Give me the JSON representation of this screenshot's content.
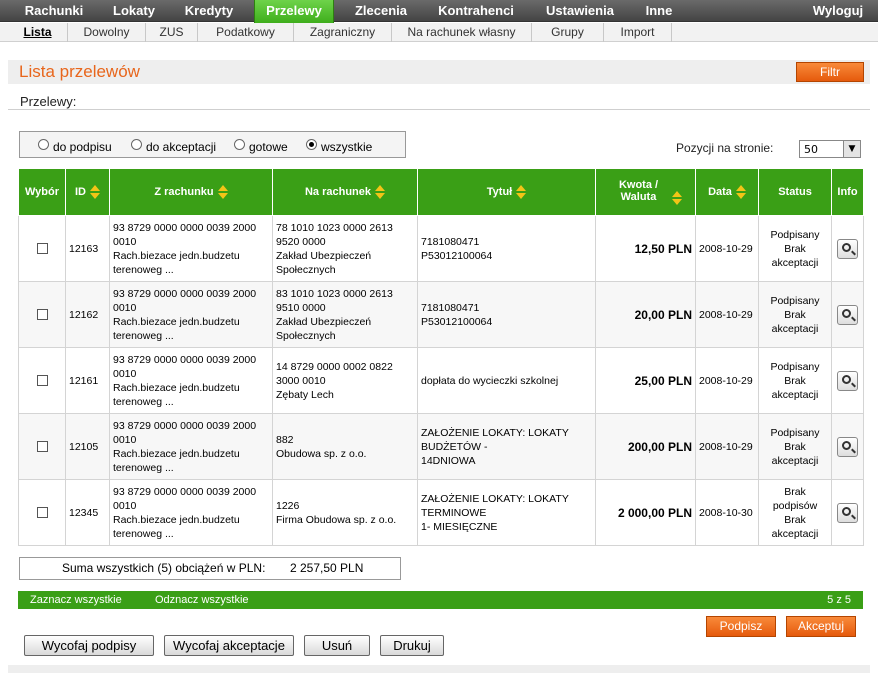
{
  "top_nav": {
    "items": [
      "Rachunki",
      "Lokaty",
      "Kredyty",
      "Przelewy",
      "Zlecenia",
      "Kontrahenci",
      "Ustawienia",
      "Inne"
    ],
    "active": "Przelewy",
    "logout": "Wyloguj"
  },
  "sub_nav": {
    "items": [
      "Lista",
      "Dowolny",
      "ZUS",
      "Podatkowy",
      "Zagraniczny",
      "Na rachunek własny",
      "Grupy",
      "Import"
    ],
    "active": "Lista"
  },
  "header": {
    "title": "Lista przelewów",
    "filter_button": "Filtr"
  },
  "section_label": "Przelewy:",
  "filter": {
    "options": [
      "do podpisu",
      "do akceptacji",
      "gotowe",
      "wszystkie"
    ],
    "selected": "wszystkie"
  },
  "per_page": {
    "label": "Pozycji na stronie:",
    "value": "50"
  },
  "table": {
    "columns": [
      "Wybór",
      "ID",
      "Z rachunku",
      "Na rachunek",
      "Tytuł",
      "Kwota / Waluta",
      "Data",
      "Status",
      "Info"
    ],
    "rows": [
      {
        "id": "12163",
        "from": [
          "93 8729 0000 0000 0039 2000 0010",
          "Rach.biezace jedn.budzetu terenoweg ..."
        ],
        "to": [
          "78 1010 1023 0000 2613 9520 0000",
          "Zakład Ubezpieczeń Społecznych"
        ],
        "title": [
          "7181080471",
          "P53012100064"
        ],
        "amount": "12,50 PLN",
        "date": "2008-10-29",
        "status": [
          "Podpisany",
          "Brak akceptacji"
        ]
      },
      {
        "id": "12162",
        "from": [
          "93 8729 0000 0000 0039 2000 0010",
          "Rach.biezace jedn.budzetu terenoweg ..."
        ],
        "to": [
          "83 1010 1023 0000 2613 9510 0000",
          "Zakład Ubezpieczeń Społecznych"
        ],
        "title": [
          "7181080471",
          "P53012100064"
        ],
        "amount": "20,00 PLN",
        "date": "2008-10-29",
        "status": [
          "Podpisany",
          "Brak akceptacji"
        ]
      },
      {
        "id": "12161",
        "from": [
          "93 8729 0000 0000 0039 2000 0010",
          "Rach.biezace jedn.budzetu terenoweg ..."
        ],
        "to": [
          "14 8729 0000 0002 0822 3000 0010",
          "Zębaty Lech"
        ],
        "title": [
          "dopłata do wycieczki szkolnej"
        ],
        "amount": "25,00 PLN",
        "date": "2008-10-29",
        "status": [
          "Podpisany",
          "Brak akceptacji"
        ]
      },
      {
        "id": "12105",
        "from": [
          "93 8729 0000 0000 0039 2000 0010",
          "Rach.biezace jedn.budzetu terenoweg ..."
        ],
        "to": [
          "882",
          "Obudowa sp. z o.o."
        ],
        "title": [
          "ZAŁOŻENIE LOKATY: LOKATY BUDŻETÓW -",
          "14DNIOWA"
        ],
        "amount": "200,00 PLN",
        "date": "2008-10-29",
        "status": [
          "Podpisany",
          "Brak akceptacji"
        ]
      },
      {
        "id": "12345",
        "from": [
          "93 8729 0000 0000 0039 2000 0010",
          "Rach.biezace jedn.budzetu terenoweg ..."
        ],
        "to": [
          "1226",
          "Firma Obudowa sp. z o.o."
        ],
        "title": [
          "ZAŁOŻENIE LOKATY: LOKATY TERMINOWE",
          "1- MIESIĘCZNE"
        ],
        "amount": "2 000,00 PLN",
        "date": "2008-10-30",
        "status": [
          "Brak podpisów",
          "Brak akceptacji"
        ]
      }
    ]
  },
  "summary": {
    "label": "Suma wszystkich (5) obciążeń w PLN:",
    "value": "2 257,50 PLN"
  },
  "footer_bar": {
    "select_all": "Zaznacz wszystkie",
    "deselect_all": "Odznacz wszystkie",
    "pagination": "5 z 5"
  },
  "actions": {
    "sign": "Podpisz",
    "accept": "Akceptuj",
    "withdraw_signatures": "Wycofaj podpisy",
    "withdraw_acceptance": "Wycofaj akceptacje",
    "delete": "Usuń",
    "print": "Drukuj"
  },
  "colors": {
    "nav_green": "#3fae1c",
    "table_green": "#3a9f16",
    "accent_orange": "#e8661c",
    "sort_arrow": "#f3c417"
  }
}
